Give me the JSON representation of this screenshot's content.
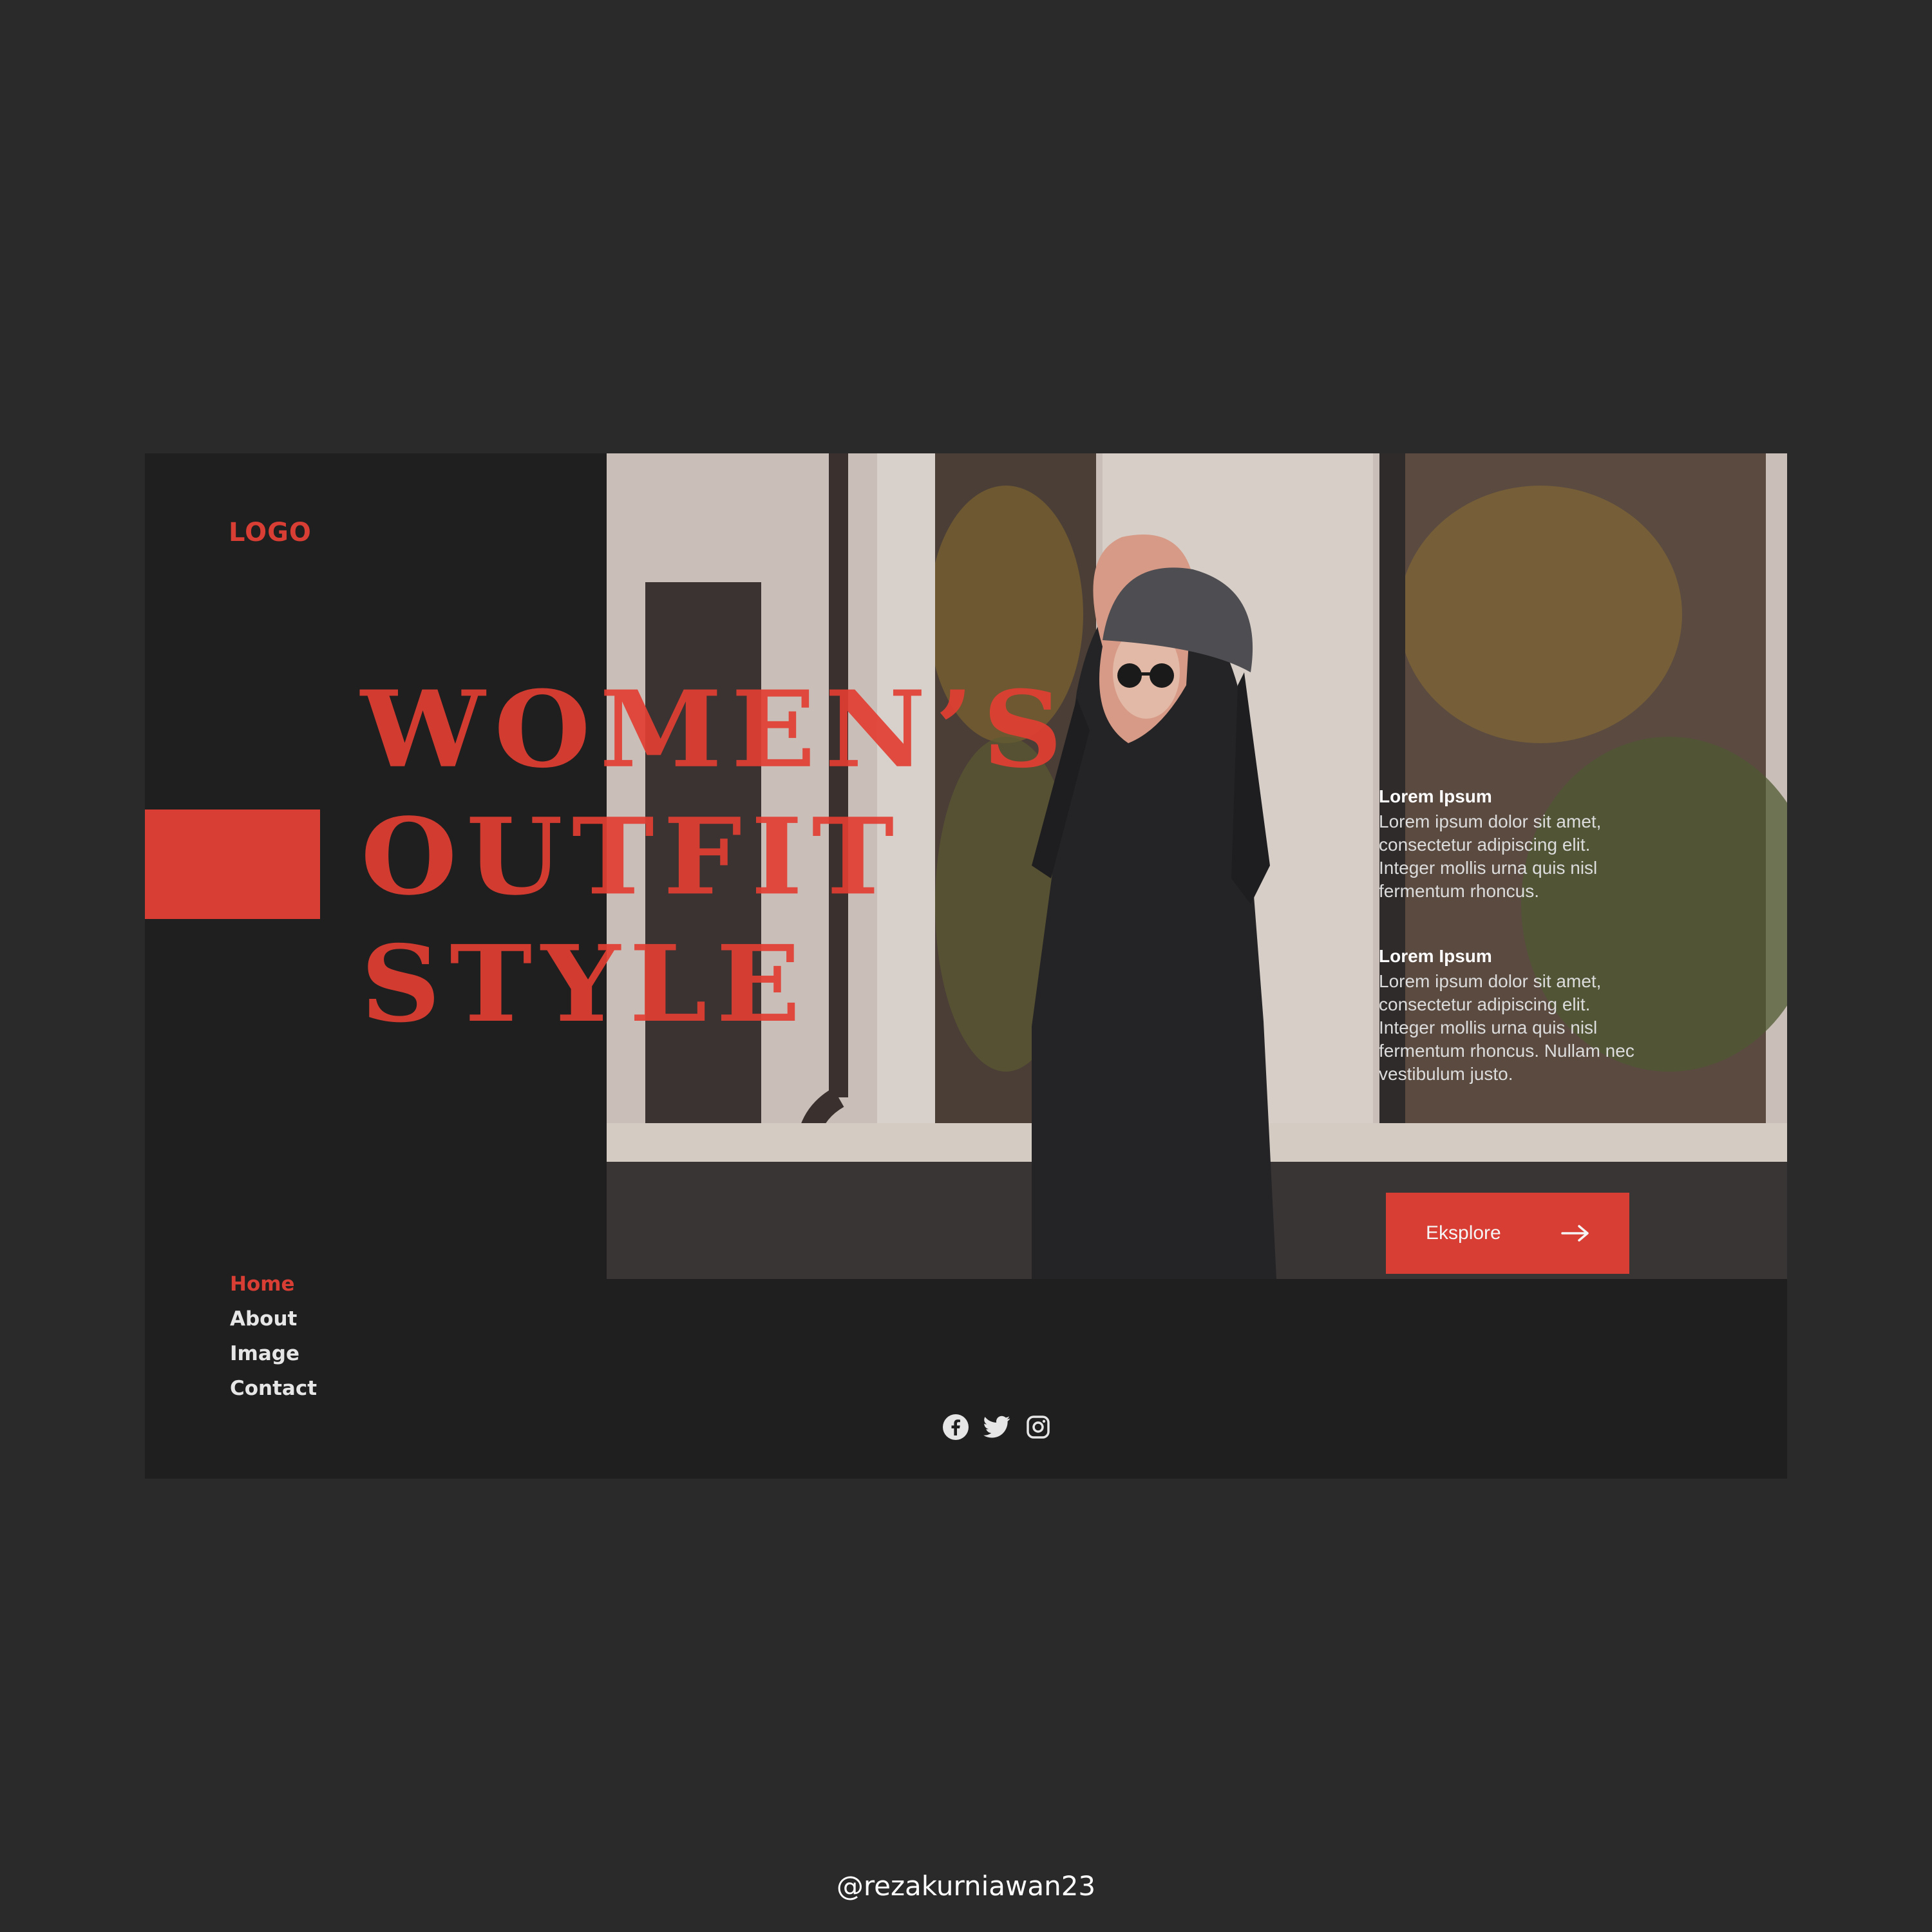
{
  "brand": {
    "logo_text": "LOGO",
    "accent_color": "#d93e34"
  },
  "hero": {
    "headline_lines": [
      "WOMEN’S",
      "OUTFIT",
      "STYLE"
    ]
  },
  "info_blocks": [
    {
      "title": "Lorem Ipsum",
      "body": "Lorem ipsum dolor sit amet, consectetur adipiscing elit. Integer mollis urna quis nisl fermentum rhoncus."
    },
    {
      "title": "Lorem Ipsum",
      "body": "Lorem ipsum dolor sit amet, consectetur adipiscing elit. Integer mollis urna quis nisl fermentum rhoncus. Nullam nec vestibulum justo."
    }
  ],
  "cta": {
    "label": "Eksplore",
    "icon": "arrow-right-icon"
  },
  "nav": {
    "items": [
      {
        "label": "Home",
        "active": true
      },
      {
        "label": "About",
        "active": false
      },
      {
        "label": "Image",
        "active": false
      },
      {
        "label": "Contact",
        "active": false
      }
    ]
  },
  "social": {
    "icons": [
      "facebook-icon",
      "twitter-icon",
      "instagram-icon"
    ]
  },
  "footer": {
    "credit": "@rezakurniawan23"
  }
}
